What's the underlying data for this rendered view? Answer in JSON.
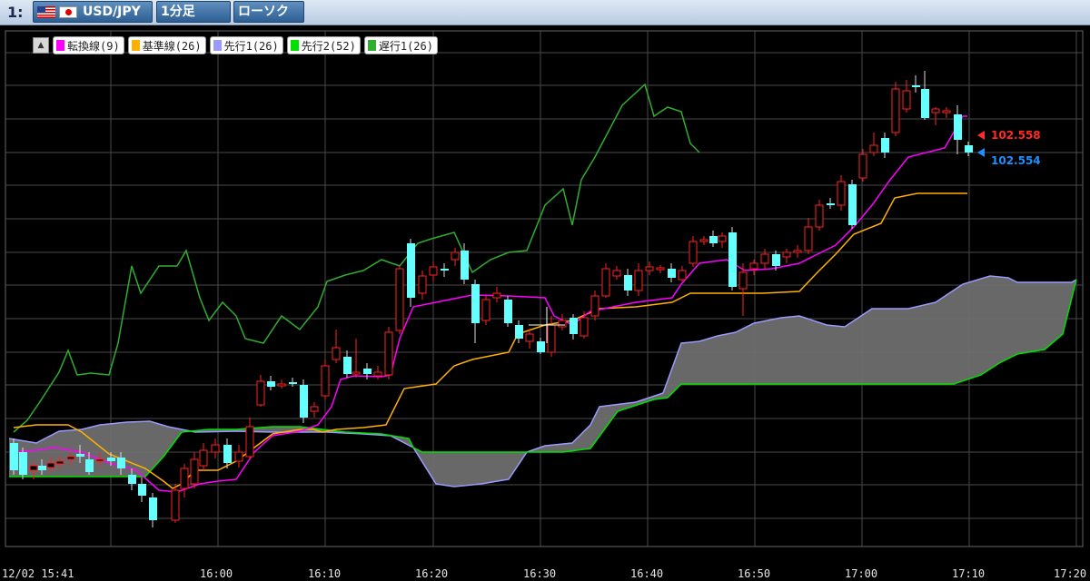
{
  "toolbar": {
    "chart_index": "1:",
    "pair": "USD/JPY",
    "timeframe": "1分足",
    "chart_type": "ローソク"
  },
  "legend": {
    "toggle_icon": "▲",
    "items": [
      {
        "label": "転換線(9)",
        "color": "#ff00ff"
      },
      {
        "label": "基準線(26)",
        "color": "#ffb000"
      },
      {
        "label": "先行1(26)",
        "color": "#9a9aff"
      },
      {
        "label": "先行2(52)",
        "color": "#00e000"
      },
      {
        "label": "遅行1(26)",
        "color": "#2fae2f"
      }
    ]
  },
  "prices": {
    "ask": {
      "value": "102.558",
      "color": "#ff2a2a"
    },
    "bid": {
      "value": "102.554",
      "color": "#1e90ff"
    }
  },
  "x_axis": {
    "labels": [
      "12/02 15:41",
      "16:00",
      "16:10",
      "16:20",
      "16:30",
      "16:40",
      "16:50",
      "17:00",
      "17:10",
      "17:20"
    ]
  },
  "colors": {
    "background": "#000000",
    "grid": "#4a4a4a",
    "bull_candle": "#ff2222",
    "bear_candle": "#66ffff",
    "kumo": "#6e6e6e"
  }
}
